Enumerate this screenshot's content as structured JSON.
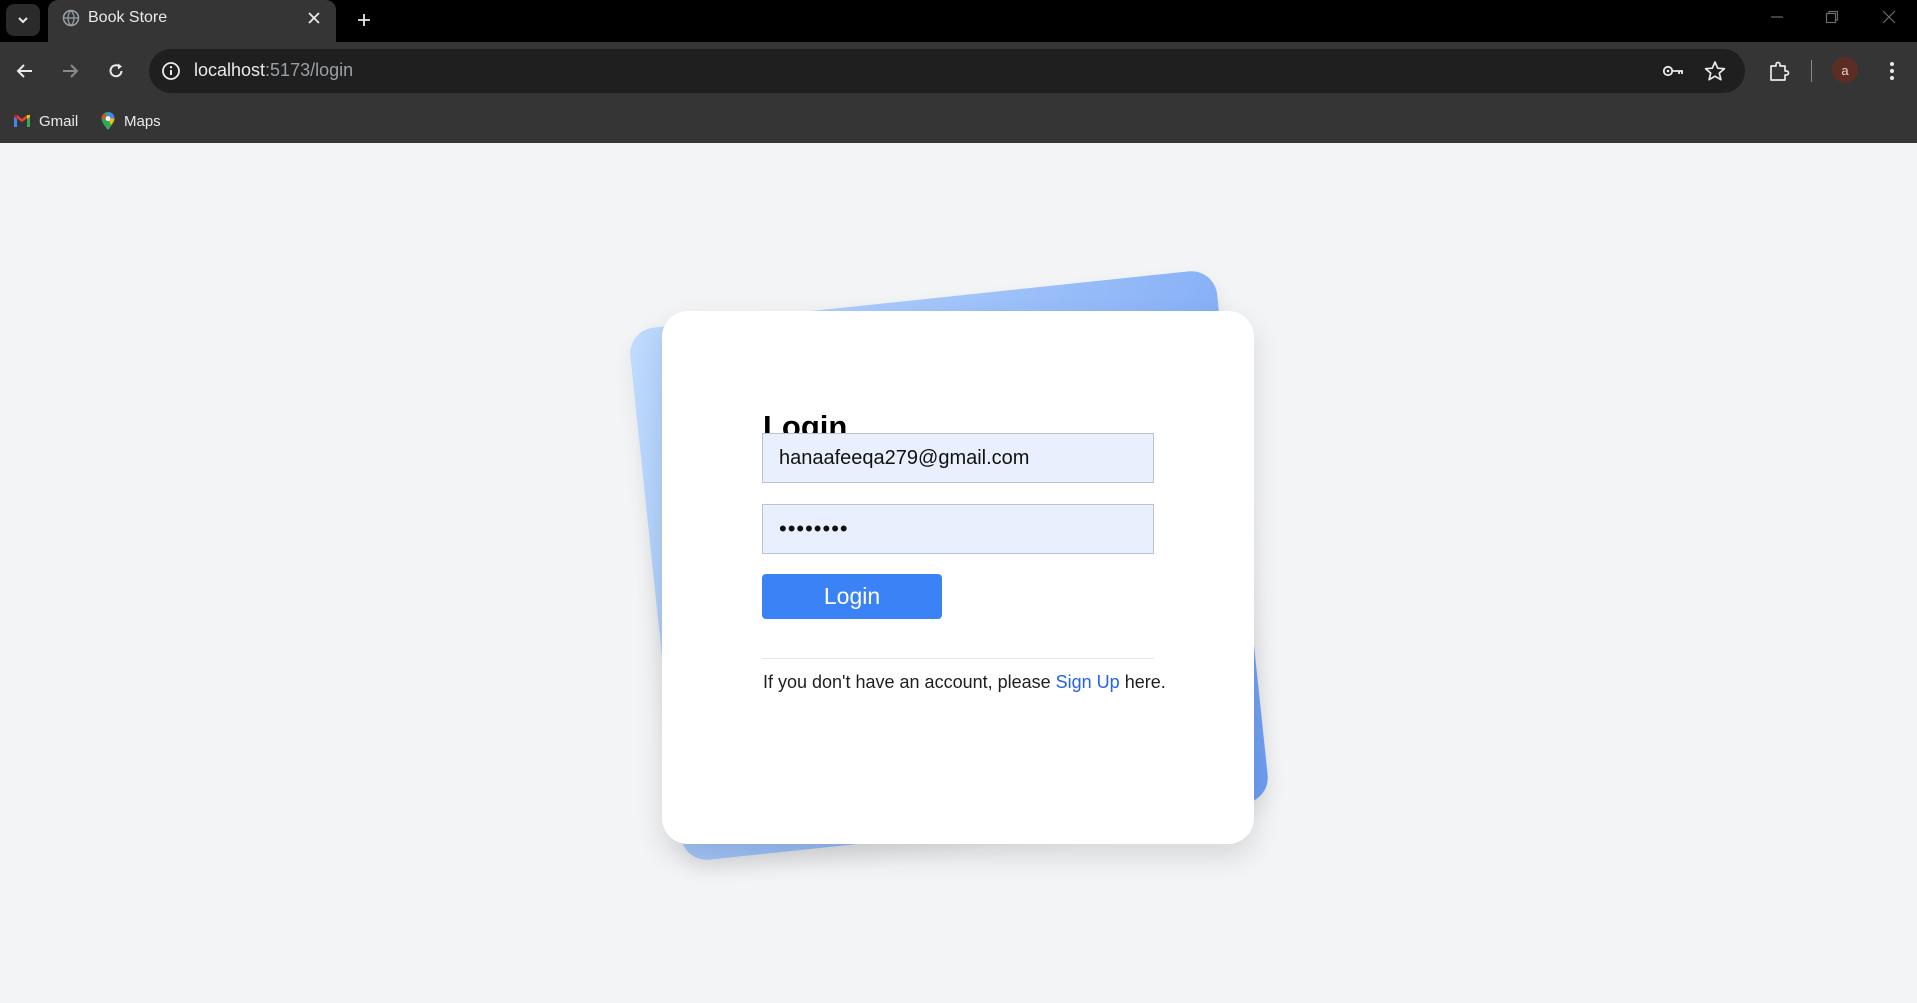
{
  "browser": {
    "tab": {
      "title": "Book Store"
    },
    "address": {
      "host": "localhost",
      "path": ":5173/login"
    },
    "bookmarks": [
      {
        "label": "Gmail",
        "icon": "gmail-icon"
      },
      {
        "label": "Maps",
        "icon": "maps-icon"
      }
    ],
    "profile_initial": "a"
  },
  "login": {
    "title": "Login",
    "email_value": "hanaafeeqa279@gmail.com",
    "password_value": "••••••••",
    "button_label": "Login",
    "signup_prefix": "If you don't have an account, please",
    "signup_link": "Sign Up",
    "signup_suffix": "here."
  },
  "colors": {
    "accent": "#3b82f6",
    "link": "#2563eb",
    "page_bg": "#f3f4f6",
    "input_bg": "#e8f0fe"
  }
}
